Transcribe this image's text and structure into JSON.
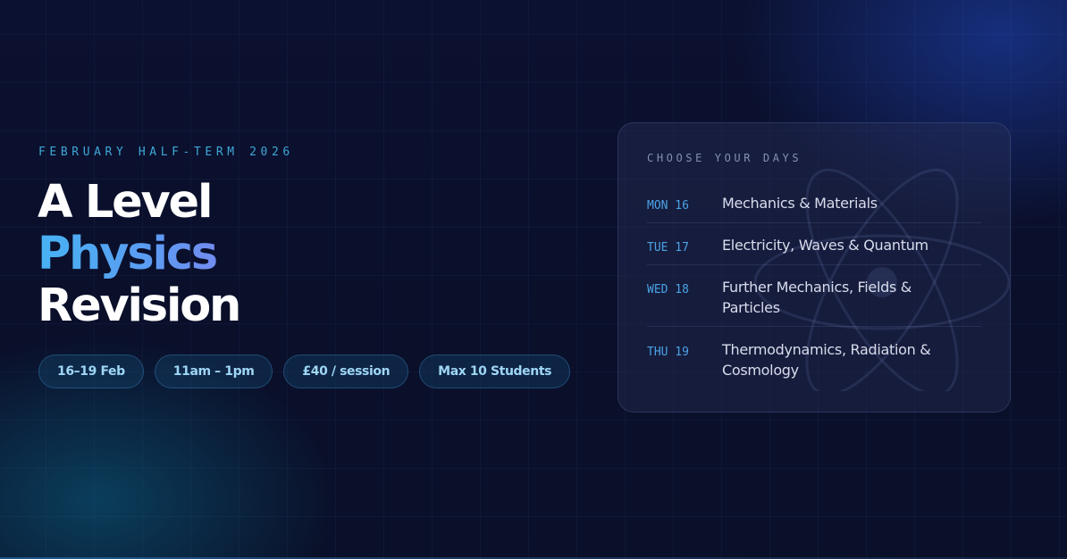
{
  "hero": {
    "eyebrow": "FEBRUARY HALF-TERM 2026",
    "title_line1": "A Level",
    "title_line2": "Physics",
    "title_line3": "Revision"
  },
  "chips": [
    {
      "label": "16–19 Feb"
    },
    {
      "label": "11am – 1pm"
    },
    {
      "label": "£40 / session"
    },
    {
      "label": "Max 10 Students"
    }
  ],
  "schedule": {
    "heading": "CHOOSE YOUR DAYS",
    "rows": [
      {
        "day": "MON 16",
        "topic": "Mechanics & Materials"
      },
      {
        "day": "TUE 17",
        "topic": "Electricity, Waves & Quantum"
      },
      {
        "day": "WED 18",
        "topic": "Further Mechanics, Fields & Particles"
      },
      {
        "day": "THU 19",
        "topic": "Thermodynamics, Radiation & Cosmology"
      }
    ]
  },
  "colors": {
    "background": "#0a0f2a",
    "accent_cyan": "#3fa7d8",
    "accent_blue": "#4aa3e6",
    "title_gradient_start": "#47b2f3",
    "title_gradient_end": "#7a86ee",
    "chip_text": "#9fd6f5"
  },
  "icons": {
    "card_background": "atom-icon"
  }
}
